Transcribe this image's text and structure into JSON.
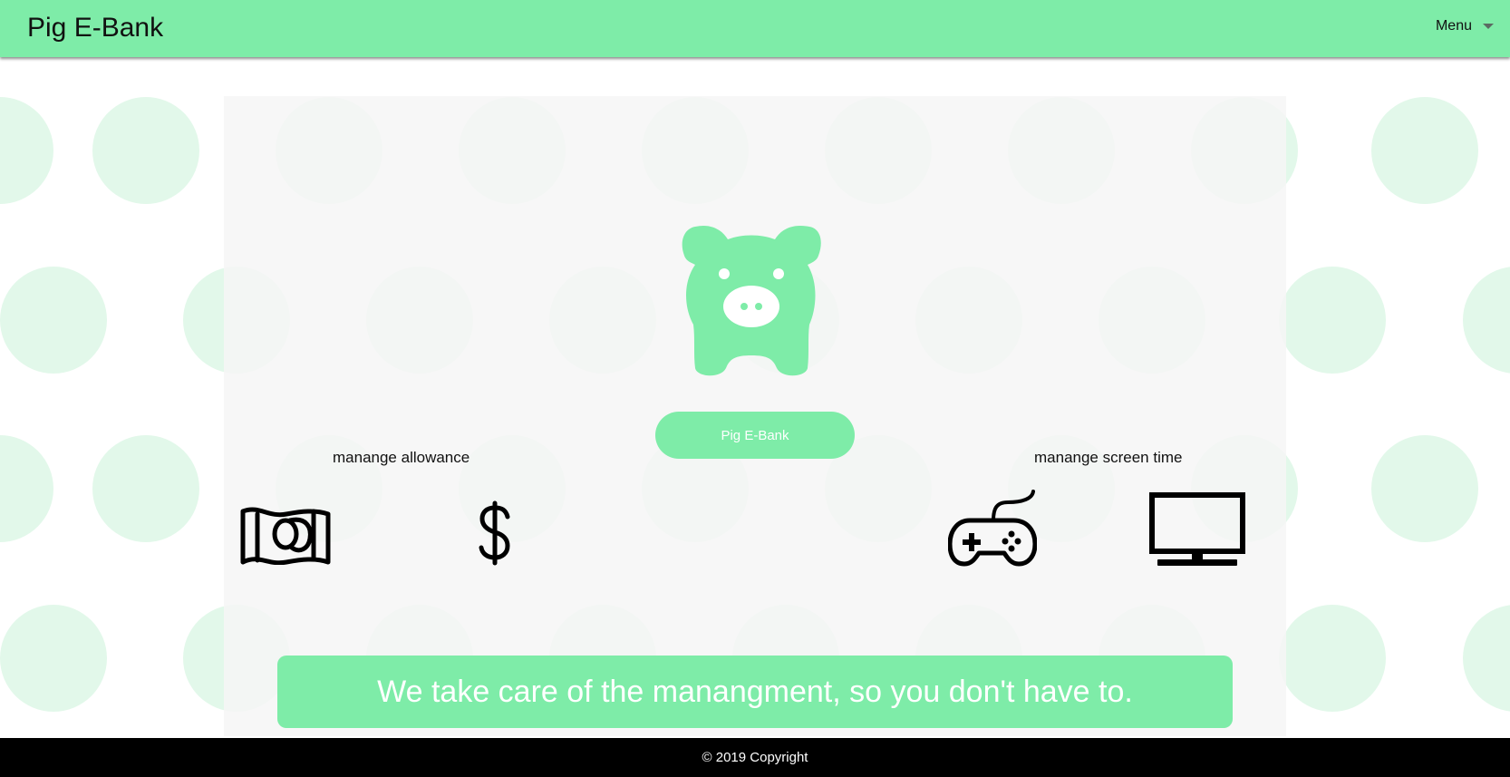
{
  "navbar": {
    "brand": "Pig E-Bank",
    "menu_label": "Menu"
  },
  "hero": {
    "logo_icon": "piggy-bank-icon",
    "button_label": "Pig E-Bank"
  },
  "features": [
    {
      "label": "manange allowance",
      "icons": [
        "money-bill-icon",
        "dollar-sign-icon"
      ]
    },
    {
      "label": "manange screen time",
      "icons": [
        "gamepad-icon",
        "tv-icon"
      ]
    }
  ],
  "banner": {
    "text": "We take care of the manangment, so you don't have to."
  },
  "footer": {
    "copyright": "© 2019 Copyright"
  },
  "colors": {
    "accent": "#7eeca8",
    "dots": "#e2f8ea",
    "panel": "#f6f6f6",
    "footer": "#000000"
  }
}
